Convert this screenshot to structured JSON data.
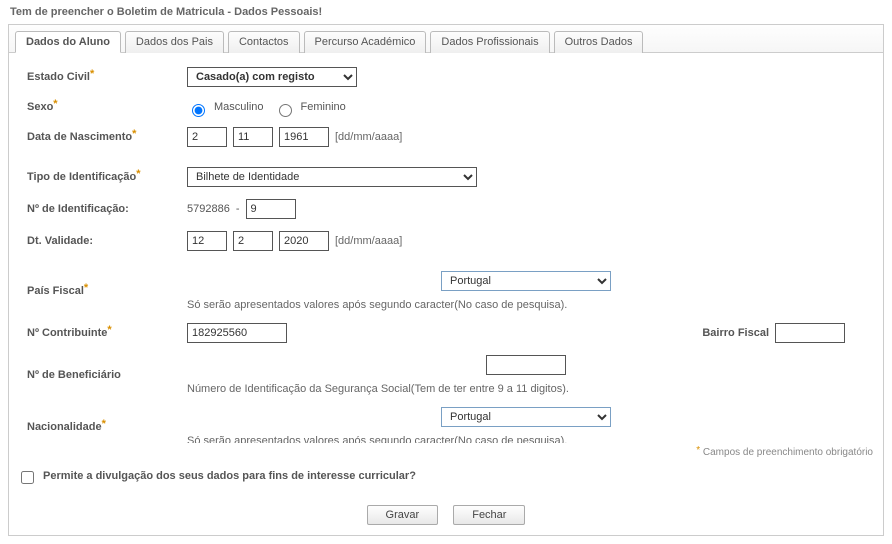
{
  "title": "Tem de preencher o Boletim de Matricula - Dados Pessoais!",
  "tabs": {
    "aluno": "Dados do Aluno",
    "pais": "Dados dos Pais",
    "contactos": "Contactos",
    "percurso": "Percurso Académico",
    "profissionais": "Dados Profissionais",
    "outros": "Outros Dados"
  },
  "labels": {
    "estado_civil": "Estado Civil",
    "sexo": "Sexo",
    "data_nascimento": "Data de Nascimento",
    "tipo_identificacao": "Tipo de Identificação",
    "n_identificacao": "Nº de Identificação:",
    "dt_validade": "Dt. Validade:",
    "pais_fiscal": "País Fiscal",
    "n_contribuinte": "Nº Contribuinte",
    "bairro_fiscal": "Bairro Fiscal",
    "n_beneficiario": "Nº de Beneficiário",
    "nacionalidade": "Nacionalidade"
  },
  "options": {
    "sexo_m": "Masculino",
    "sexo_f": "Feminino"
  },
  "values": {
    "estado_civil": "Casado(a) com registo",
    "sexo": "M",
    "nasc_d": "2",
    "nasc_m": "11",
    "nasc_y": "1961",
    "tipo_identificacao": "Bilhete de Identidade",
    "n_ident_prefix": "5792886",
    "n_ident_digit": "9",
    "val_d": "12",
    "val_m": "2",
    "val_y": "2020",
    "pais_fiscal": "Portugal",
    "n_contribuinte": "182925560",
    "bairro_fiscal": "",
    "n_beneficiario": "",
    "nacionalidade": "Portugal"
  },
  "hints": {
    "date_format": "[dd/mm/aaaa]",
    "pesquisa": "Só serão apresentados valores após segundo caracter(No caso de pesquisa).",
    "beneficiario": "Número de Identificação da Segurança Social(Tem de ter entre 9 a 11 digitos)."
  },
  "footer": {
    "required_note": "Campos de preenchimento obrigatório",
    "divulgacao": "Permite a divulgação dos seus dados para fins de interesse curricular?"
  },
  "buttons": {
    "gravar": "Gravar",
    "fechar": "Fechar"
  }
}
